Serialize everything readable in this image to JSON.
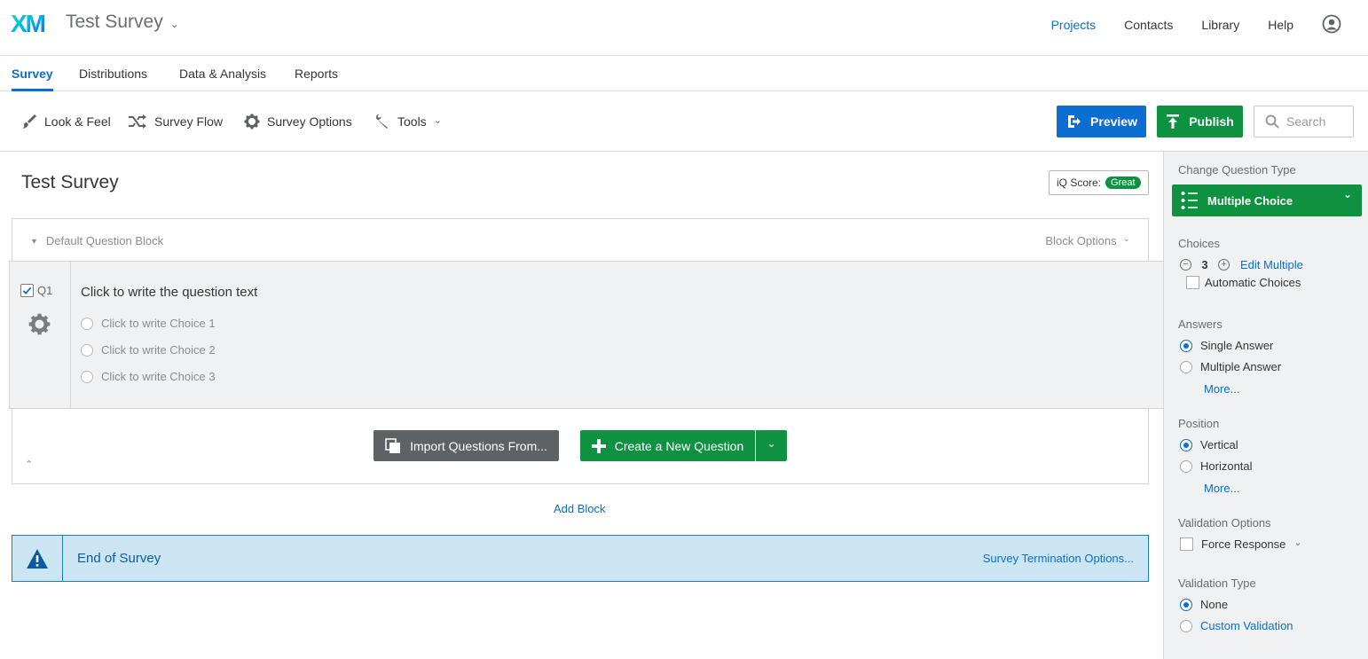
{
  "header": {
    "logo_text": "XM",
    "app_title": "Test Survey",
    "nav": [
      "Projects",
      "Contacts",
      "Library",
      "Help"
    ],
    "active_nav": "Projects"
  },
  "tabs": [
    {
      "label": "Survey",
      "active": true
    },
    {
      "label": "Distributions",
      "active": false
    },
    {
      "label": "Data & Analysis",
      "active": false
    },
    {
      "label": "Reports",
      "active": false
    }
  ],
  "toolbar": {
    "look_feel": "Look & Feel",
    "survey_flow": "Survey Flow",
    "survey_options": "Survey Options",
    "tools": "Tools",
    "preview": "Preview",
    "publish": "Publish",
    "search_placeholder": "Search"
  },
  "survey": {
    "title": "Test Survey",
    "iq_score_label": "iQ Score:",
    "iq_score_value": "Great",
    "block": {
      "name": "Default Question Block",
      "options_label": "Block Options"
    },
    "question": {
      "number": "Q1",
      "text": "Click to write the question text",
      "choices": [
        "Click to write Choice 1",
        "Click to write Choice 2",
        "Click to write Choice 3"
      ]
    },
    "import_button": "Import Questions From...",
    "create_button": "Create a New Question",
    "add_block": "Add Block",
    "end_of_survey": "End of Survey",
    "termination_options": "Survey Termination Options..."
  },
  "panel": {
    "change_type_label": "Change Question Type",
    "question_type": "Multiple Choice",
    "choices_label": "Choices",
    "choices_count": "3",
    "edit_multiple": "Edit Multiple",
    "automatic_choices": "Automatic Choices",
    "answers_label": "Answers",
    "single_answer": "Single Answer",
    "multiple_answer": "Multiple Answer",
    "more_1": "More...",
    "position_label": "Position",
    "vertical": "Vertical",
    "horizontal": "Horizontal",
    "more_2": "More...",
    "validation_options_label": "Validation Options",
    "force_response": "Force Response",
    "validation_type_label": "Validation Type",
    "none": "None",
    "custom_validation": "Custom Validation"
  },
  "colors": {
    "brand_blue": "#0b6ed0",
    "brand_green": "#0e9241",
    "end_bg": "#cce5f3"
  }
}
